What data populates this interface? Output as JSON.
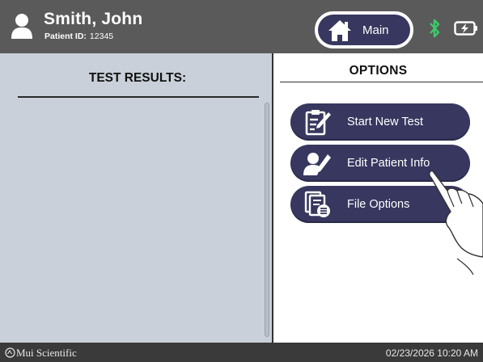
{
  "header": {
    "patient_name": "Smith, John",
    "patient_id_label": "Patient ID:",
    "patient_id_value": "12345",
    "main_button_label": "Main",
    "icons": [
      "user-icon",
      "home-icon",
      "bluetooth-icon",
      "battery-charging-icon"
    ],
    "bluetooth_color": "#3ec96a"
  },
  "results": {
    "title": "TEST RESULTS:"
  },
  "options": {
    "title": "OPTIONS",
    "buttons": [
      {
        "label": "Start New Test",
        "icon": "clipboard-edit-icon"
      },
      {
        "label": "Edit Patient Info",
        "icon": "edit-user-icon"
      },
      {
        "label": "File Options",
        "icon": "file-list-icon"
      }
    ]
  },
  "footer": {
    "brand": "Mui Scientific",
    "datetime": "02/23/2026 10:20 AM"
  },
  "colors": {
    "header_bg": "#5a5a5a",
    "button_bg": "#37375f",
    "left_panel_bg": "#c9d0d9",
    "footer_bg": "#3a3a3a"
  }
}
